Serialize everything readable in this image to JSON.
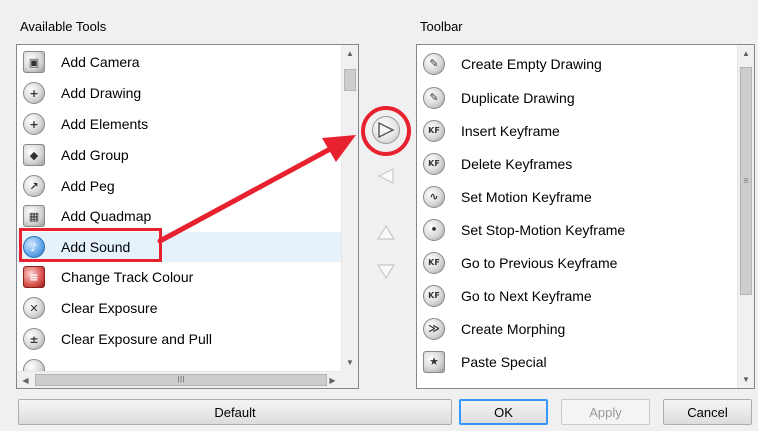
{
  "available_tools": {
    "label": "Available Tools",
    "items": [
      {
        "label": "Add Camera",
        "icon": "camera-icon"
      },
      {
        "label": "Add Drawing",
        "icon": "plus-icon"
      },
      {
        "label": "Add Elements",
        "icon": "plus-icon"
      },
      {
        "label": "Add Group",
        "icon": "group-icon"
      },
      {
        "label": "Add Peg",
        "icon": "peg-icon"
      },
      {
        "label": "Add Quadmap",
        "icon": "quadmap-icon"
      },
      {
        "label": "Add Sound",
        "icon": "sound-icon"
      },
      {
        "label": "Change Track Colour",
        "icon": "track-colour-icon"
      },
      {
        "label": "Clear Exposure",
        "icon": "clear-exposure-icon"
      },
      {
        "label": "Clear Exposure and Pull",
        "icon": "clear-exposure-pull-icon"
      },
      {
        "label": "",
        "icon": "partial-item-icon"
      }
    ],
    "hscroll_thumb_glyph": "III"
  },
  "toolbar": {
    "label": "Toolbar",
    "items": [
      {
        "label": "Create Empty Drawing",
        "icon": "create-empty-drawing-icon"
      },
      {
        "label": "Duplicate Drawing",
        "icon": "duplicate-drawing-icon"
      },
      {
        "label": "Insert Keyframe",
        "icon": "insert-keyframe-icon"
      },
      {
        "label": "Delete Keyframes",
        "icon": "delete-keyframe-icon"
      },
      {
        "label": "Set Motion Keyframe",
        "icon": "motion-keyframe-icon"
      },
      {
        "label": "Set Stop-Motion Keyframe",
        "icon": "stop-motion-keyframe-icon"
      },
      {
        "label": "Go to Previous Keyframe",
        "icon": "previous-keyframe-icon"
      },
      {
        "label": "Go to Next Keyframe",
        "icon": "next-keyframe-icon"
      },
      {
        "label": "Create Morphing",
        "icon": "morphing-icon"
      },
      {
        "label": "Paste Special",
        "icon": "paste-special-icon"
      }
    ]
  },
  "selected_item": "Add Sound",
  "icon_glyphs": {
    "camera": "▣",
    "plus": "+",
    "group": "◆",
    "peg": "↗",
    "quadmap": "▦",
    "sound": "♪",
    "track": "≡",
    "clear": "✕",
    "pull": "±",
    "kf": "KF",
    "motion": "∿",
    "stop_motion": "•",
    "morph": "≫",
    "paste": "★",
    "drawing": "✎"
  },
  "buttons": {
    "default": "Default",
    "ok": "OK",
    "apply": "Apply",
    "cancel": "Cancel"
  },
  "colors": {
    "annotation_red": "#e8212e",
    "selection": "#e5f1fb",
    "focus_blue": "#3399ff"
  }
}
